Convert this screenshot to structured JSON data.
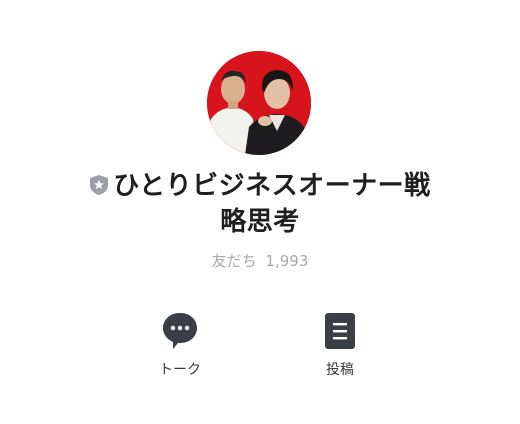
{
  "profile": {
    "name_line1": "ひとりビジネスオーナー戦",
    "name_line2": "略思考",
    "badge_icon": "shield-star-icon",
    "friends_label": "友だち",
    "friends_count": "1,993"
  },
  "actions": [
    {
      "label": "トーク",
      "icon": "chat-bubble-icon"
    },
    {
      "label": "投稿",
      "icon": "post-document-icon"
    }
  ],
  "colors": {
    "avatar_background": "#d7141b",
    "icon_dark": "#3a3f46",
    "muted_text": "#a9a9a9"
  }
}
